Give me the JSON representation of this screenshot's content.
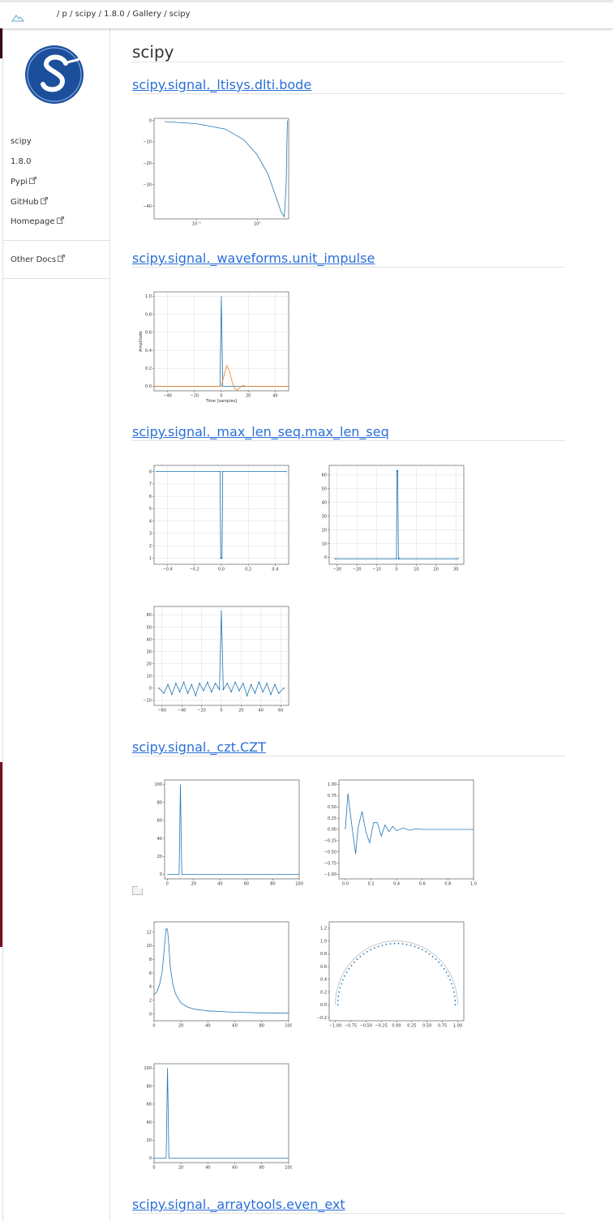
{
  "breadcrumb": {
    "root": "/ p",
    "sep1": "/",
    "item1": "scipy",
    "sep2": "/",
    "item2": "1.8.0",
    "sep3": "/",
    "item3": "Gallery",
    "sep4": "/",
    "item4": "scipy"
  },
  "sidebar": {
    "items": [
      {
        "label": "scipy"
      },
      {
        "label": "1.8.0"
      },
      {
        "label": "Pypi"
      },
      {
        "label": "GitHub"
      },
      {
        "label": "Homepage"
      },
      {
        "label": "Other Docs"
      }
    ]
  },
  "page": {
    "title": "scipy"
  },
  "sections": [
    {
      "title": "scipy.signal._ltisys.dlti.bode"
    },
    {
      "title": "scipy.signal._waveforms.unit_impulse"
    },
    {
      "title": "scipy.signal._max_len_seq.max_len_seq"
    },
    {
      "title": "scipy.signal._czt.CZT"
    },
    {
      "title": "scipy.signal._arraytools.even_ext"
    }
  ],
  "colors": {
    "link": "#2a6fd6",
    "line": "#1f77b4",
    "line2": "#ff7f0e",
    "brand": "#1b4f9c"
  },
  "chart_data": [
    {
      "id": "bode",
      "type": "line",
      "x_scale": "log",
      "yticks": [
        "0",
        "−10",
        "−20",
        "−30",
        "−40"
      ],
      "xticks": [
        "10⁻¹",
        "10⁰"
      ],
      "ylim": [
        -46,
        1
      ],
      "x": [
        0.03,
        0.1,
        0.3,
        0.6,
        1,
        1.5,
        2,
        2.5,
        2.8,
        3.0,
        3.14
      ],
      "y": [
        -0.5,
        -1.5,
        -4,
        -9,
        -16,
        -25,
        -35,
        -43,
        -45,
        -30,
        0
      ]
    },
    {
      "id": "impulse",
      "type": "line",
      "ylabel": "Amplitude",
      "xlabel": "Time [samples]",
      "yticks": [
        "0.0",
        "0.2",
        "0.4",
        "0.6",
        "0.8",
        "1.0"
      ],
      "xticks": [
        "−40",
        "−20",
        "0",
        "20",
        "40"
      ],
      "xlim": [
        -50,
        50
      ],
      "ylim": [
        -0.05,
        1.05
      ],
      "series": [
        {
          "x": [
            -50,
            -1,
            0,
            1,
            50
          ],
          "y": [
            0,
            0,
            1,
            0,
            0
          ]
        },
        {
          "x": [
            -50,
            0,
            2,
            4,
            6,
            8,
            10,
            12,
            14,
            16,
            18,
            20,
            50
          ],
          "y": [
            0,
            0,
            0.12,
            0.23,
            0.17,
            0.05,
            -0.03,
            -0.04,
            -0.01,
            0.01,
            0,
            0,
            0
          ]
        }
      ]
    },
    {
      "id": "mls1",
      "type": "line",
      "yticks": [
        "1",
        "2",
        "3",
        "4",
        "5",
        "6",
        "7",
        "8"
      ],
      "xticks": [
        "−0.4",
        "−0.2",
        "0.0",
        "0.2",
        "0.4"
      ],
      "xlim": [
        -0.5,
        0.5
      ],
      "ylim": [
        0.5,
        8.5
      ],
      "x": [
        -0.48,
        -0.01,
        -0.005,
        0,
        0.005,
        0.01,
        0.48
      ],
      "y": [
        8,
        8,
        1,
        1,
        1,
        8,
        8
      ]
    },
    {
      "id": "mls2",
      "type": "line",
      "yticks": [
        "0",
        "10",
        "20",
        "30",
        "40",
        "50",
        "60"
      ],
      "xticks": [
        "−30",
        "−20",
        "−10",
        "0",
        "10",
        "20",
        "30"
      ],
      "xlim": [
        -34,
        34
      ],
      "ylim": [
        -5,
        67
      ],
      "x": [
        -31,
        0,
        0.2,
        0.6,
        1,
        1.4,
        31
      ],
      "y": [
        -1,
        -1,
        63,
        63,
        -1,
        -1,
        -1
      ]
    },
    {
      "id": "mls3",
      "type": "line",
      "yticks": [
        "−10",
        "0",
        "10",
        "20",
        "30",
        "40",
        "50",
        "60"
      ],
      "xticks": [
        "−60",
        "−40",
        "−20",
        "0",
        "20",
        "40",
        "60"
      ],
      "xlim": [
        -68,
        68
      ],
      "ylim": [
        -14,
        67
      ],
      "x": [
        -63,
        -58,
        -54,
        -50,
        -46,
        -42,
        -38,
        -34,
        -30,
        -26,
        -22,
        -18,
        -14,
        -10,
        -6,
        -2,
        0,
        2,
        6,
        10,
        14,
        18,
        22,
        26,
        30,
        34,
        38,
        42,
        46,
        50,
        54,
        58,
        63
      ],
      "y": [
        0,
        -4,
        3,
        -5,
        4,
        -3,
        5,
        -4,
        3,
        -6,
        4,
        -2,
        5,
        -3,
        4,
        -1,
        63,
        -1,
        4,
        -3,
        5,
        -2,
        4,
        -6,
        3,
        -4,
        5,
        -3,
        4,
        -5,
        3,
        -4,
        0
      ]
    },
    {
      "id": "czt1",
      "type": "line",
      "yticks": [
        "0",
        "20",
        "40",
        "60",
        "80",
        "100"
      ],
      "xticks": [
        "0",
        "20",
        "40",
        "60",
        "80",
        "100"
      ],
      "xlim": [
        -2,
        100
      ],
      "ylim": [
        -5,
        105
      ],
      "x": [
        0,
        9,
        10,
        11,
        100
      ],
      "y": [
        0,
        0,
        100,
        0,
        0
      ]
    },
    {
      "id": "czt2",
      "type": "line",
      "yticks": [
        "−1.00",
        "−0.75",
        "−0.50",
        "−0.25",
        "0.00",
        "0.25",
        "0.50",
        "0.75",
        "1.00"
      ],
      "xticks": [
        "0.0",
        "0.2",
        "0.4",
        "0.6",
        "0.8",
        "1.0"
      ],
      "xlim": [
        -0.05,
        1.0
      ],
      "ylim": [
        -1.1,
        1.1
      ],
      "x": [
        0,
        0.02,
        0.05,
        0.08,
        0.1,
        0.13,
        0.16,
        0.19,
        0.22,
        0.25,
        0.28,
        0.31,
        0.34,
        0.37,
        0.4,
        0.45,
        0.5,
        0.55,
        0.6,
        0.7,
        0.8,
        1.0
      ],
      "y": [
        0,
        0.8,
        0.1,
        -0.55,
        0.05,
        0.4,
        -0.05,
        -0.3,
        0.15,
        0.15,
        -0.15,
        0.1,
        -0.05,
        0.07,
        -0.03,
        0.03,
        -0.02,
        0.01,
        0,
        0,
        0,
        0
      ]
    },
    {
      "id": "czt3",
      "type": "line",
      "yticks": [
        "0",
        "2",
        "4",
        "6",
        "8",
        "10",
        "12"
      ],
      "xticks": [
        "0",
        "20",
        "40",
        "60",
        "80",
        "100"
      ],
      "xlim": [
        0,
        100
      ],
      "ylim": [
        -1,
        13.5
      ],
      "x": [
        0,
        2,
        4,
        6,
        8,
        9,
        10,
        11,
        12,
        14,
        16,
        20,
        25,
        30,
        40,
        60,
        80,
        100
      ],
      "y": [
        2.8,
        3.2,
        4.2,
        6.2,
        10.5,
        12.5,
        12.4,
        10,
        7,
        4.3,
        2.9,
        1.6,
        1,
        0.7,
        0.45,
        0.25,
        0.15,
        0.1
      ]
    },
    {
      "id": "czt4",
      "type": "scatter",
      "yticks": [
        "−0.2",
        "0.0",
        "0.2",
        "0.4",
        "0.6",
        "0.8",
        "1.0",
        "1.2"
      ],
      "xticks": [
        "−1.00",
        "−0.75",
        "−0.50",
        "−0.25",
        "0.00",
        "0.25",
        "0.50",
        "0.75",
        "1.00"
      ],
      "xlim": [
        -1.1,
        1.1
      ],
      "ylim": [
        -0.25,
        1.3
      ]
    },
    {
      "id": "czt5",
      "type": "line",
      "yticks": [
        "0",
        "20",
        "40",
        "60",
        "80",
        "100"
      ],
      "xticks": [
        "0",
        "20",
        "40",
        "60",
        "80",
        "100"
      ],
      "xlim": [
        0,
        100
      ],
      "ylim": [
        -5,
        105
      ],
      "x": [
        0,
        9,
        10,
        11,
        100
      ],
      "y": [
        0,
        0,
        100,
        0,
        0
      ]
    }
  ]
}
